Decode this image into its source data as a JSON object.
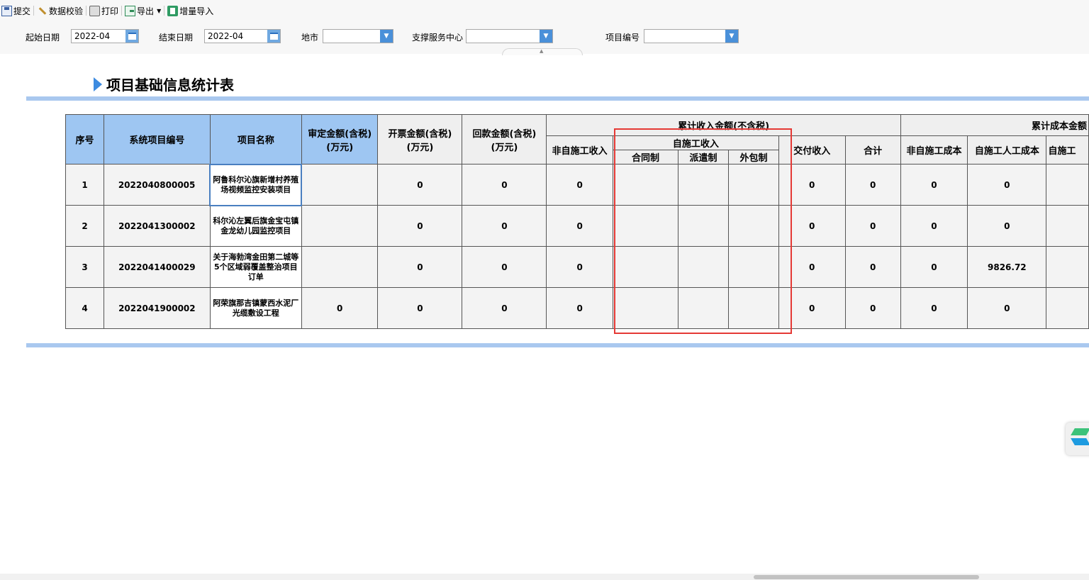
{
  "toolbar": {
    "submit": "提交",
    "validate": "数据校验",
    "print": "打印",
    "export": "导出",
    "incremental_import": "增量导入"
  },
  "filters": {
    "start_date_label": "起始日期",
    "start_date_value": "2022-04",
    "end_date_label": "结束日期",
    "end_date_value": "2022-04",
    "city_label": "地市",
    "city_value": "",
    "service_center_label": "支撑服务中心",
    "service_center_value": "",
    "project_no_label": "项目编号",
    "project_no_value": ""
  },
  "report": {
    "title": "项目基础信息统计表"
  },
  "table": {
    "headers": {
      "seq": "序号",
      "sys_project_no": "系统项目编号",
      "project_name": "项目名称",
      "approved_amount": "审定金额(含税)",
      "approved_amount_unit": "(万元)",
      "invoice_amount": "开票金额(含税)",
      "invoice_amount_unit": "(万元)",
      "payment_amount": "回款金额(含税)",
      "payment_amount_unit": "(万元)",
      "cum_income": "累计收入金额(不含税)",
      "non_self_income": "非自施工收入",
      "self_income": "自施工收入",
      "contract": "合同制",
      "dispatch": "派遣制",
      "outsource": "外包制",
      "delivery_income": "交付收入",
      "total": "合计",
      "cum_cost": "累计成本金额",
      "non_self_cost": "非自施工成本",
      "self_labor_cost": "自施工人工成本",
      "self_other": "自施工"
    },
    "rows": [
      {
        "seq": "1",
        "sys_no": "2022040800005",
        "name": "阿鲁科尔沁旗新增村养殖场视频监控安装项目",
        "approved": "",
        "invoice": "0",
        "payment": "0",
        "non_self": "0",
        "contract": "",
        "dispatch": "",
        "outsource": "",
        "delivery": "0",
        "total": "0",
        "non_self_cost": "0",
        "self_labor_cost": "0"
      },
      {
        "seq": "2",
        "sys_no": "2022041300002",
        "name": "科尔沁左翼后旗金宝屯镇金龙幼儿园监控项目",
        "approved": "",
        "invoice": "0",
        "payment": "0",
        "non_self": "0",
        "contract": "",
        "dispatch": "",
        "outsource": "",
        "delivery": "0",
        "total": "0",
        "non_self_cost": "0",
        "self_labor_cost": "0"
      },
      {
        "seq": "3",
        "sys_no": "2022041400029",
        "name": "关于海勃湾金田第二城等5个区域弱覆盖整治项目订单",
        "approved": "",
        "invoice": "0",
        "payment": "0",
        "non_self": "0",
        "contract": "",
        "dispatch": "",
        "outsource": "",
        "delivery": "0",
        "total": "0",
        "non_self_cost": "0",
        "self_labor_cost": "9826.72"
      },
      {
        "seq": "4",
        "sys_no": "2022041900002",
        "name": "阿荣旗那吉镇蒙西水泥厂光缆敷设工程",
        "approved": "0",
        "invoice": "0",
        "payment": "0",
        "non_self": "0",
        "contract": "",
        "dispatch": "",
        "outsource": "",
        "delivery": "0",
        "total": "0",
        "non_self_cost": "0",
        "self_labor_cost": "0"
      }
    ]
  },
  "colors": {
    "header_blue": "#9ec6f2",
    "rule_blue": "#a9c8ef",
    "highlight_red": "#e53935"
  }
}
